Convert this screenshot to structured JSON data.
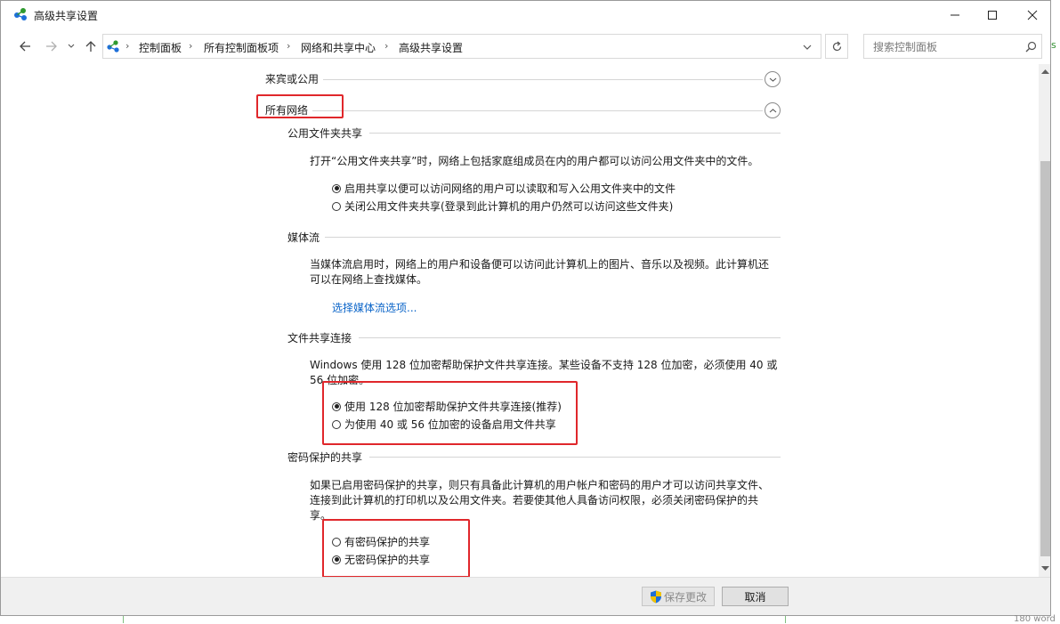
{
  "window": {
    "title": "高级共享设置",
    "controls": {
      "minimize": "minimize",
      "maximize": "maximize",
      "close": "close"
    }
  },
  "address": {
    "breadcrumbs": [
      "控制面板",
      "所有控制面板项",
      "网络和共享中心",
      "高级共享设置"
    ],
    "search_placeholder": "搜索控制面板"
  },
  "profiles": {
    "guest_public": "来宾或公用",
    "all_networks": "所有网络"
  },
  "sections": {
    "public_folder": {
      "title": "公用文件夹共享",
      "desc": "打开“公用文件夹共享”时，网络上包括家庭组成员在内的用户都可以访问公用文件夹中的文件。",
      "options": [
        {
          "label": "启用共享以便可以访问网络的用户可以读取和写入公用文件夹中的文件",
          "selected": true
        },
        {
          "label": "关闭公用文件夹共享(登录到此计算机的用户仍然可以访问这些文件夹)",
          "selected": false
        }
      ]
    },
    "media": {
      "title": "媒体流",
      "desc": "当媒体流启用时，网络上的用户和设备便可以访问此计算机上的图片、音乐以及视频。此计算机还可以在网络上查找媒体。",
      "link": "选择媒体流选项..."
    },
    "file_sharing": {
      "title": "文件共享连接",
      "desc": "Windows 使用 128 位加密帮助保护文件共享连接。某些设备不支持 128 位加密，必须使用 40 或 56 位加密。",
      "options": [
        {
          "label": "使用 128 位加密帮助保护文件共享连接(推荐)",
          "selected": true
        },
        {
          "label": "为使用 40 或 56 位加密的设备启用文件共享",
          "selected": false
        }
      ]
    },
    "password": {
      "title": "密码保护的共享",
      "desc": "如果已启用密码保护的共享，则只有具备此计算机的用户帐户和密码的用户才可以访问共享文件、连接到此计算机的打印机以及公用文件夹。若要使其他人具备访问权限，必须关闭密码保护的共享。",
      "options": [
        {
          "label": "有密码保护的共享",
          "selected": false
        },
        {
          "label": "无密码保护的共享",
          "selected": true
        }
      ]
    }
  },
  "footer": {
    "save": "保存更改",
    "cancel": "取消"
  },
  "background": {
    "corner_text": "180 word",
    "right_edge_text": "s"
  },
  "colors": {
    "link": "#0a64c8",
    "highlight": "#e0272b",
    "accent": "#1e6fd9"
  }
}
